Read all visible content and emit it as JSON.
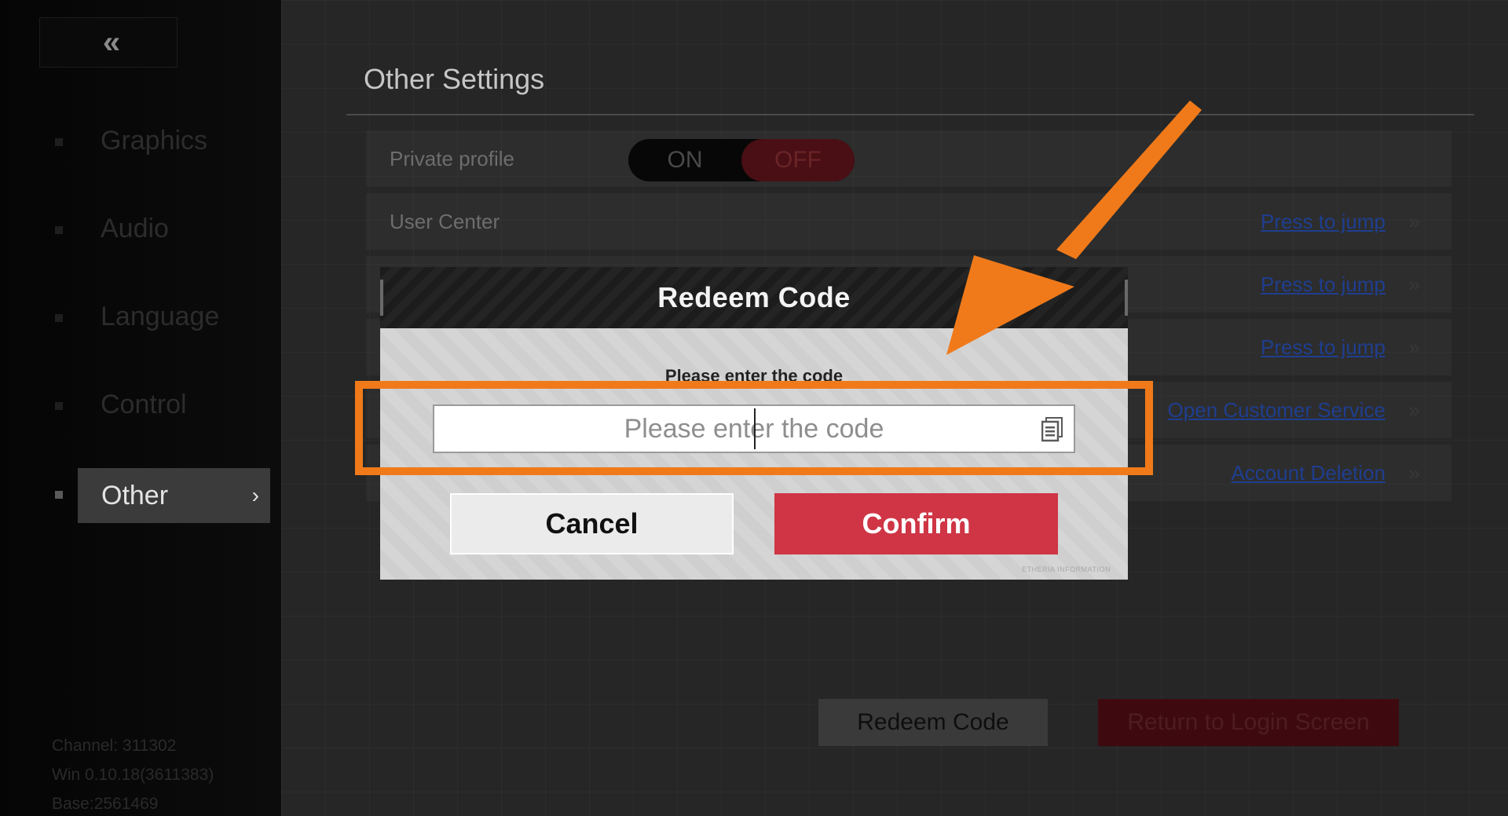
{
  "sidebar": {
    "back_glyph": "«",
    "items": [
      {
        "label": "Graphics"
      },
      {
        "label": "Audio"
      },
      {
        "label": "Language"
      },
      {
        "label": "Control"
      },
      {
        "label": "Other"
      }
    ],
    "active_chevron": "›",
    "version": {
      "channel": "Channel: 311302",
      "build": "Win 0.10.18(3611383)",
      "base": "Base:2561469"
    }
  },
  "main": {
    "section_title": "Other Settings",
    "rows": [
      {
        "label": "Private profile"
      },
      {
        "label": "User Center",
        "link": "Press to jump"
      },
      {
        "label": "",
        "link": "Press to jump"
      },
      {
        "label": "",
        "link": "Press to jump"
      },
      {
        "label": "",
        "link": "Open Customer Service"
      },
      {
        "label": "",
        "link": "Account Deletion"
      }
    ],
    "toggle": {
      "on_label": "ON",
      "off_label": "OFF",
      "selected": "OFF"
    },
    "bottom_buttons": {
      "redeem_label": "Redeem Code",
      "return_label": "Return to Login Screen"
    }
  },
  "modal": {
    "title": "Redeem Code",
    "prompt": "Please enter the code",
    "input_placeholder": "Please enter the code",
    "input_value": "",
    "cancel_label": "Cancel",
    "confirm_label": "Confirm",
    "brand": "ETHERIA INFORMATION"
  },
  "colors": {
    "annotation_orange": "#f07a1a",
    "confirm_red": "#cf3545",
    "link_blue": "#1f3e8f"
  }
}
